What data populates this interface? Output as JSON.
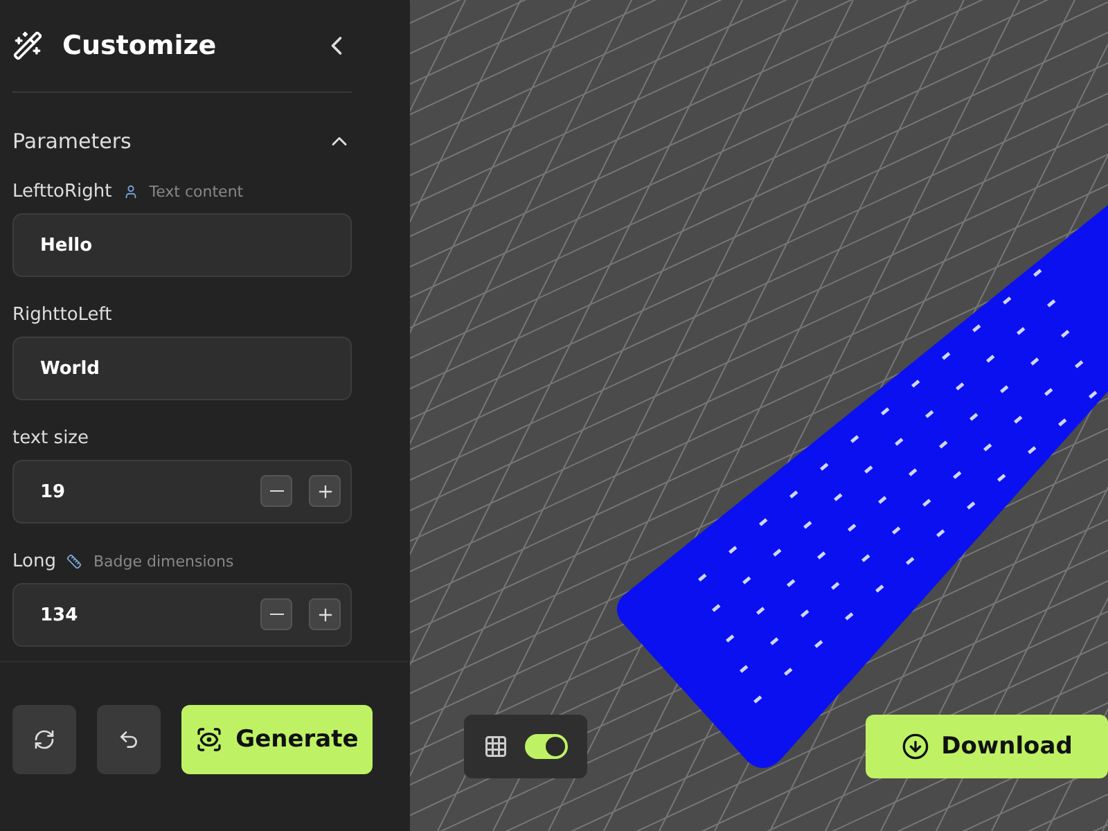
{
  "sidebar": {
    "title": "Customize",
    "section": {
      "title": "Parameters",
      "expanded": true,
      "fields": [
        {
          "kind": "text",
          "label": "LefttoRight",
          "hint": "Text content",
          "value": "Hello"
        },
        {
          "kind": "text",
          "label": "RighttoLeft",
          "value": "World"
        },
        {
          "kind": "number",
          "label": "text size",
          "value": "19"
        },
        {
          "kind": "number",
          "label": "Long",
          "hint": "Badge dimensions",
          "value": "134"
        }
      ]
    },
    "generate_button": "Generate"
  },
  "viewport": {
    "grid_visible": true,
    "download_button": "Download"
  }
}
